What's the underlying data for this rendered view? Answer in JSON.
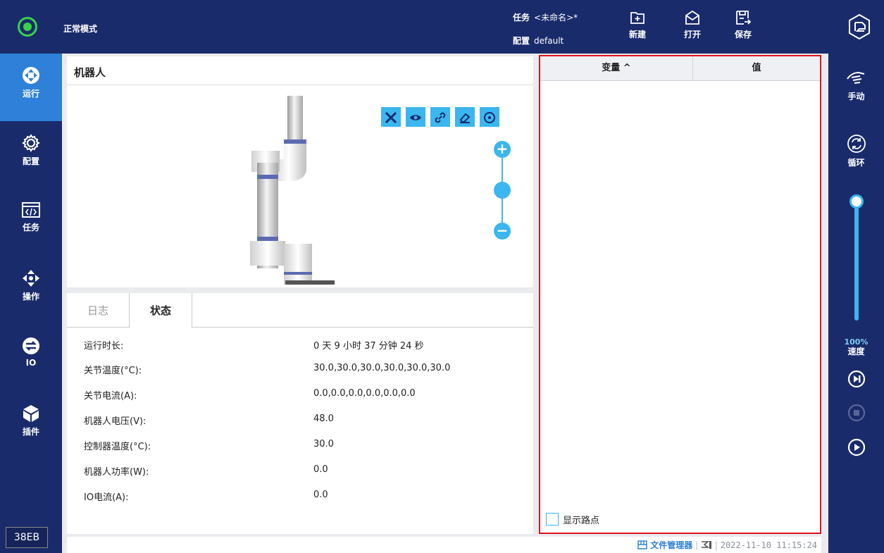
{
  "topbar": {
    "mode": "正常模式",
    "task_label": "任务",
    "task_value": "<未命名>*",
    "config_label": "配置",
    "config_value": "default",
    "new_label": "新建",
    "open_label": "打开",
    "save_label": "保存"
  },
  "sidebar": {
    "items": [
      {
        "label": "运行",
        "icon": "run-icon",
        "active": true
      },
      {
        "label": "配置",
        "icon": "gear-icon"
      },
      {
        "label": "任务",
        "icon": "code-window-icon"
      },
      {
        "label": "操作",
        "icon": "move-arrows-icon"
      },
      {
        "label": "IO",
        "icon": "io-icon"
      },
      {
        "label": "插件",
        "icon": "cube-icon"
      }
    ],
    "version": "38EB"
  },
  "robot_panel": {
    "title": "机器人",
    "tools": [
      "tool-icon",
      "eye-icon",
      "link-icon",
      "eraser-icon",
      "target-icon"
    ]
  },
  "status_panel": {
    "tabs": [
      "日志",
      "状态"
    ],
    "rows": [
      {
        "label": "运行时长:",
        "value": "0 天 9 小时 37 分钟 24 秒"
      },
      {
        "label": "关节温度(°C):",
        "value": "30.0,30.0,30.0,30.0,30.0,30.0"
      },
      {
        "label": "关节电流(A):",
        "value": "0.0,0.0,0.0,0.0,0.0,0.0"
      },
      {
        "label": "机器人电压(V):",
        "value": "48.0"
      },
      {
        "label": "控制器温度(°C):",
        "value": "30.0"
      },
      {
        "label": "机器人功率(W):",
        "value": "0.0"
      },
      {
        "label": "IO电流(A):",
        "value": "0.0"
      }
    ]
  },
  "variables": {
    "col_name": "变量 ^",
    "col_value": "值",
    "show_waypoints": "显示路点"
  },
  "rightbar": {
    "manual_label": "手动",
    "loop_label": "循环",
    "speed_value": "100%",
    "speed_label": "速度",
    "speed_fraction": 1.0
  },
  "footer": {
    "file_manager": "文件管理器",
    "timestamp": "2022-11-10 11:15:24"
  }
}
